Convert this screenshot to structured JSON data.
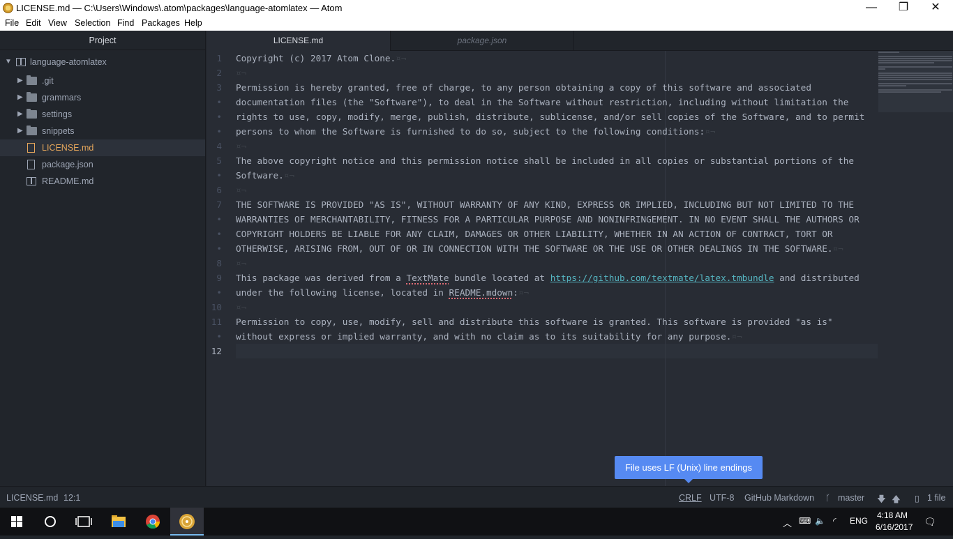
{
  "window": {
    "title": "LICENSE.md — C:\\Users\\Windows\\.atom\\packages\\language-atomlatex — Atom",
    "minimize": "—",
    "maximize": "❐",
    "close": "✕"
  },
  "menu": [
    "File",
    "Edit",
    "View",
    "Selection",
    "Find",
    "Packages",
    "Help"
  ],
  "tree": {
    "header": "Project",
    "root": "language-atomlatex",
    "items": [
      {
        "label": ".git",
        "kind": "folder"
      },
      {
        "label": "grammars",
        "kind": "folder"
      },
      {
        "label": "settings",
        "kind": "folder"
      },
      {
        "label": "snippets",
        "kind": "folder"
      },
      {
        "label": "LICENSE.md",
        "kind": "file",
        "selected": true
      },
      {
        "label": "package.json",
        "kind": "file"
      },
      {
        "label": "README.md",
        "kind": "book"
      }
    ]
  },
  "tabs": [
    {
      "label": "LICENSE.md",
      "active": true
    },
    {
      "label": "package.json",
      "active": false
    }
  ],
  "editor": {
    "gutter": [
      "1",
      "2",
      "3",
      "•",
      "•",
      "•",
      "4",
      "5",
      "•",
      "6",
      "7",
      "•",
      "•",
      "•",
      "8",
      "9",
      "•",
      "10",
      "11",
      "•",
      "12"
    ],
    "lines": {
      "l1": "Copyright (c) 2017 Atom Clone.",
      "l3a": "Permission is hereby granted, free of charge, to any person obtaining a copy of this software and associated",
      "l3b": "documentation files (the \"Software\"), to deal in the Software without restriction, including without limitation the",
      "l3c": "rights to use, copy, modify, merge, publish, distribute, sublicense, and/or sell copies of the Software, and to permit",
      "l3d": "persons to whom the Software is furnished to do so, subject to the following conditions:",
      "l5a": "The above copyright notice and this permission notice shall be included in all copies or substantial portions of the",
      "l5b": "Software.",
      "l7a": "THE SOFTWARE IS PROVIDED \"AS IS\", WITHOUT WARRANTY OF ANY KIND, EXPRESS OR IMPLIED, INCLUDING BUT NOT LIMITED TO THE",
      "l7b": "WARRANTIES OF MERCHANTABILITY, FITNESS FOR A PARTICULAR PURPOSE AND NONINFRINGEMENT. IN NO EVENT SHALL THE AUTHORS OR",
      "l7c": "COPYRIGHT HOLDERS BE LIABLE FOR ANY CLAIM, DAMAGES OR OTHER LIABILITY, WHETHER IN AN ACTION OF CONTRACT, TORT OR",
      "l7d": "OTHERWISE, ARISING FROM, OUT OF OR IN CONNECTION WITH THE SOFTWARE OR THE USE OR OTHER DEALINGS IN THE SOFTWARE.",
      "l9a_pre": "This package was derived from a ",
      "l9a_spell": "TextMate",
      "l9a_mid": " bundle located at ",
      "l9a_link": "https://github.com/textmate/latex.tmbundle",
      "l9a_post": " and distributed",
      "l9b_pre": "under the following license, located in ",
      "l9b_spell": "README.mdown",
      "l9b_post": ":",
      "l11a": "Permission to copy, use, modify, sell and distribute this software is granted. This software is provided \"as is\"",
      "l11b": "without express or implied warranty, and with no claim as to its suitability for any purpose."
    },
    "eol": "¤¬"
  },
  "tooltip": "File uses LF (Unix) line endings",
  "status": {
    "file": "LICENSE.md",
    "cursor": "12:1",
    "line_ending": "CRLF",
    "encoding": "UTF-8",
    "grammar": "GitHub Markdown",
    "branch": "master",
    "changes": "1 file"
  },
  "taskbar": {
    "lang": "ENG",
    "time": "4:18 AM",
    "date": "6/16/2017"
  }
}
